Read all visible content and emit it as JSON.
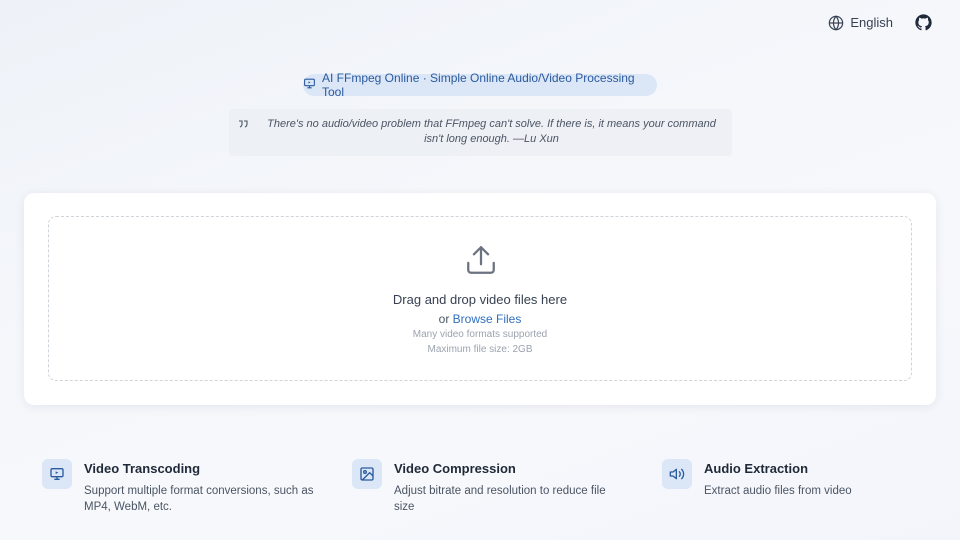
{
  "header": {
    "language_label": "English",
    "icons": {
      "language": "globe-icon",
      "github": "github-icon"
    }
  },
  "hero": {
    "badge_text": "AI FFmpeg Online · Simple Online Audio/Video Processing Tool",
    "quote_text": "There's no audio/video problem that FFmpeg can't solve. If there is, it means your command isn't long enough.",
    "quote_author": "—Lu Xun"
  },
  "upload": {
    "title": "Drag and drop video files here",
    "browse_prefix": "or",
    "browse_link": "Browse Files",
    "formats_hint": "Many video formats supported",
    "size_hint": "Maximum file size: 2GB"
  },
  "features": [
    {
      "title": "Video Transcoding",
      "description": "Support multiple format conversions, such as MP4, WebM, etc.",
      "icon": "monitor-play-icon"
    },
    {
      "title": "Video Compression",
      "description": "Adjust bitrate and resolution to reduce file size",
      "icon": "image-icon"
    },
    {
      "title": "Audio Extraction",
      "description": "Extract audio files from video",
      "icon": "volume-icon"
    }
  ],
  "colors": {
    "accent": "#2f6fc0",
    "badge_bg": "#dbe7f7",
    "badge_text": "#2b5a9e"
  }
}
